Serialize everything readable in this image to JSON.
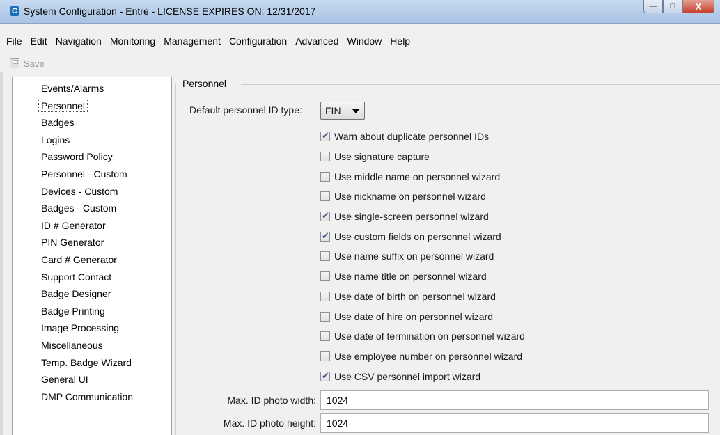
{
  "window": {
    "title": "System Configuration - Entré - LICENSE EXPIRES ON: 12/31/2017",
    "app_icon": "C",
    "controls": {
      "minimize": "—",
      "maximize": "□",
      "close": "X"
    }
  },
  "menu": [
    "File",
    "Edit",
    "Navigation",
    "Monitoring",
    "Management",
    "Configuration",
    "Advanced",
    "Window",
    "Help"
  ],
  "toolbar": {
    "save_label": "Save",
    "save_icon": "floppy-disk-icon"
  },
  "sidebar": {
    "selected": "Personnel",
    "items": [
      "Events/Alarms",
      "Personnel",
      "Badges",
      "Logins",
      "Password Policy",
      "Personnel - Custom",
      "Devices - Custom",
      "Badges - Custom",
      "ID # Generator",
      "PIN Generator",
      "Card # Generator",
      "Support Contact",
      "Badge Designer",
      "Badge Printing",
      "Image Processing",
      "Miscellaneous",
      "Temp. Badge Wizard",
      "General UI",
      "DMP Communication"
    ]
  },
  "main": {
    "group_title": "Personnel",
    "id_type_label": "Default personnel ID type:",
    "id_type_value": "FIN",
    "options": [
      {
        "label": "Warn about duplicate personnel IDs",
        "checked": true
      },
      {
        "label": "Use signature capture",
        "checked": false
      },
      {
        "label": "Use middle name on personnel wizard",
        "checked": false
      },
      {
        "label": "Use nickname on personnel wizard",
        "checked": false
      },
      {
        "label": "Use single-screen personnel wizard",
        "checked": true
      },
      {
        "label": "Use custom fields on personnel wizard",
        "checked": true
      },
      {
        "label": "Use name suffix on personnel wizard",
        "checked": false
      },
      {
        "label": "Use name title on personnel wizard",
        "checked": false
      },
      {
        "label": "Use date of birth on personnel wizard",
        "checked": false
      },
      {
        "label": "Use date of hire on personnel wizard",
        "checked": false
      },
      {
        "label": "Use date of termination on personnel wizard",
        "checked": false
      },
      {
        "label": "Use employee number on personnel wizard",
        "checked": false
      },
      {
        "label": "Use CSV personnel import wizard",
        "checked": true
      }
    ],
    "photo_width_label": "Max. ID photo width:",
    "photo_width_value": "1024",
    "photo_height_label": "Max. ID photo height:",
    "photo_height_value": "1024"
  }
}
